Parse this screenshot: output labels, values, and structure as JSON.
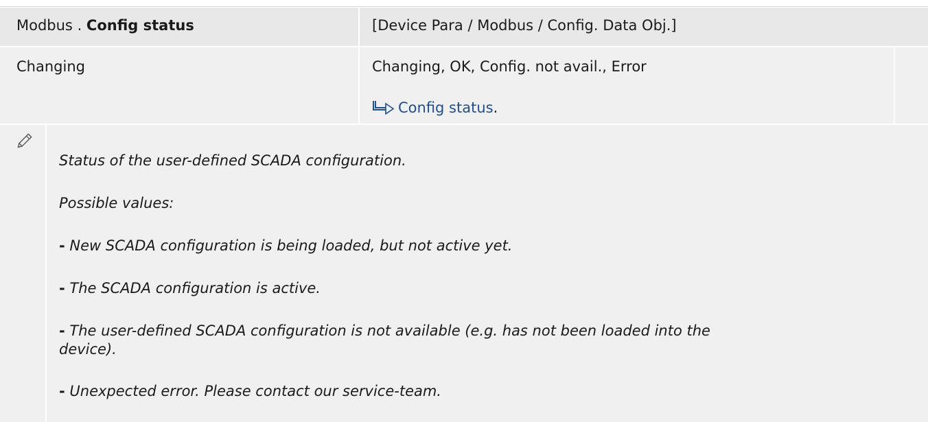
{
  "header": {
    "module": "Modbus",
    "separator": " . ",
    "title": "Config status",
    "path": "[Device Para / Modbus / Config. Data Obj.]"
  },
  "value_row": {
    "default": "Changing",
    "options": "Changing, OK, Config. not avail., Error",
    "reference_link": "Config status",
    "reference_suffix": "."
  },
  "description": {
    "icon": "pencil-icon",
    "lines": [
      "Status of the user-defined SCADA configuration.",
      "Possible values:",
      "New SCADA configuration is being loaded, but not active yet.",
      "The SCADA configuration is active.",
      "The user-defined SCADA configuration is not available (e.g. has not been loaded into the",
      "device).",
      "Unexpected error. Please contact our service-team."
    ],
    "bullet": "-"
  },
  "colors": {
    "cell_background": "#f0f0f0",
    "header_background": "#e8e8e8",
    "link": "#1d4f91"
  }
}
